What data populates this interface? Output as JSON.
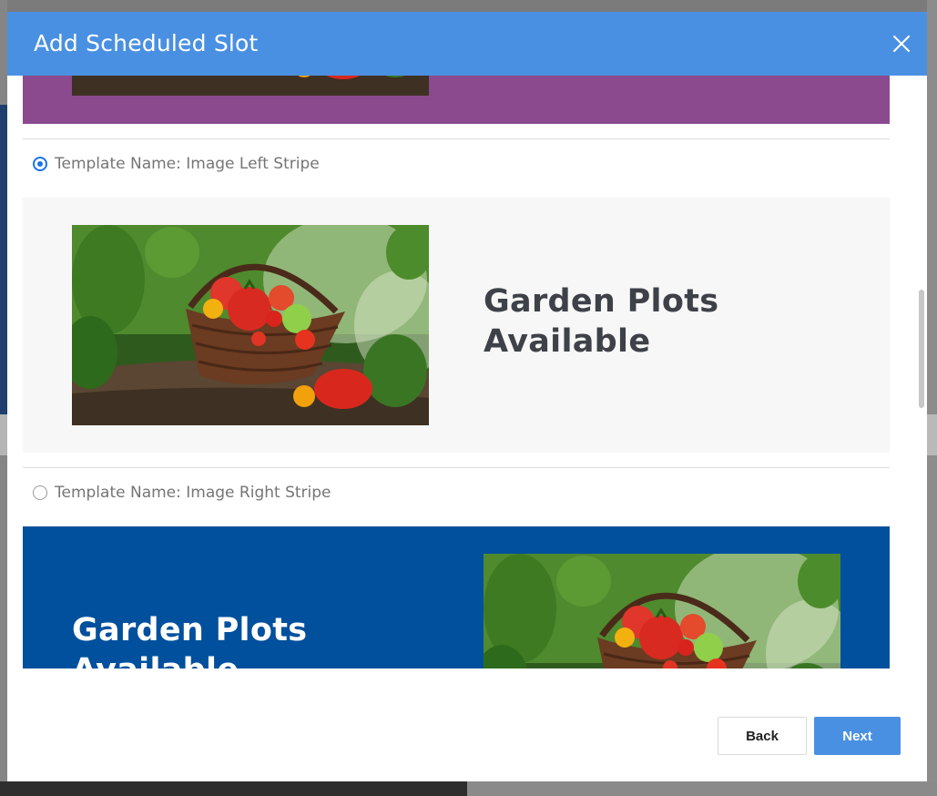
{
  "modal": {
    "title": "Add Scheduled Slot",
    "close_icon": "close-icon"
  },
  "templates": [
    {
      "label": "Template Name: Image Left Stripe",
      "selected": true,
      "heading": "Garden Plots Available",
      "background": "#f7f7f7",
      "text_color": "#3e4248"
    },
    {
      "label": "Template Name: Image Right Stripe",
      "selected": false,
      "heading": "Garden Plots Available",
      "background": "#00509d",
      "text_color": "#ffffff"
    }
  ],
  "previous_template": {
    "background": "#8a4a8d"
  },
  "footer": {
    "back_label": "Back",
    "next_label": "Next"
  },
  "colors": {
    "header": "#4a90e2",
    "radio_selected": "#1a73e8",
    "primary_button": "#4a90e2"
  }
}
